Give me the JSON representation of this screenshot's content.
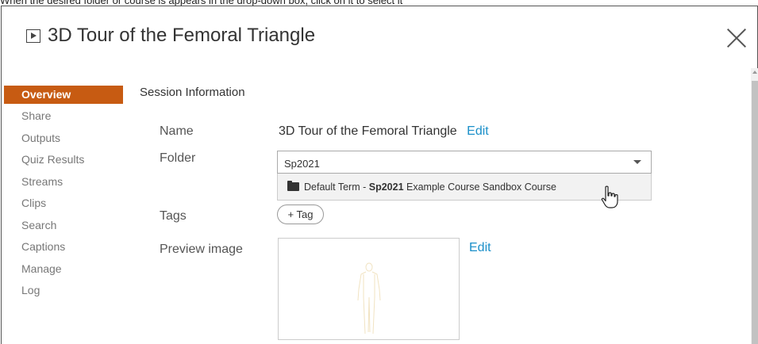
{
  "caption": "When the desired folder or course is appears in the drop-down box, click on it to select it",
  "dialog": {
    "title": "3D Tour of the Femoral Triangle",
    "icon": "play-icon",
    "close_icon": "close-icon"
  },
  "sidebar": {
    "items": [
      {
        "label": "Overview",
        "active": true
      },
      {
        "label": "Share"
      },
      {
        "label": "Outputs"
      },
      {
        "label": "Quiz Results"
      },
      {
        "label": "Streams"
      },
      {
        "label": "Clips"
      },
      {
        "label": "Search"
      },
      {
        "label": "Captions"
      },
      {
        "label": "Manage"
      },
      {
        "label": "Log"
      }
    ]
  },
  "main": {
    "section_title": "Session Information",
    "name": {
      "label": "Name",
      "value": "3D Tour of the Femoral Triangle",
      "edit": "Edit"
    },
    "folder": {
      "label": "Folder",
      "input_value": "Sp2021",
      "option": {
        "prefix": "Default Term - ",
        "match": "Sp2021",
        "suffix": " Example Course Sandbox Course"
      }
    },
    "tags": {
      "label": "Tags",
      "button": "+ Tag"
    },
    "preview": {
      "label": "Preview image",
      "edit": "Edit"
    }
  },
  "colors": {
    "accent": "#c75b12",
    "link": "#1a8fc9"
  }
}
